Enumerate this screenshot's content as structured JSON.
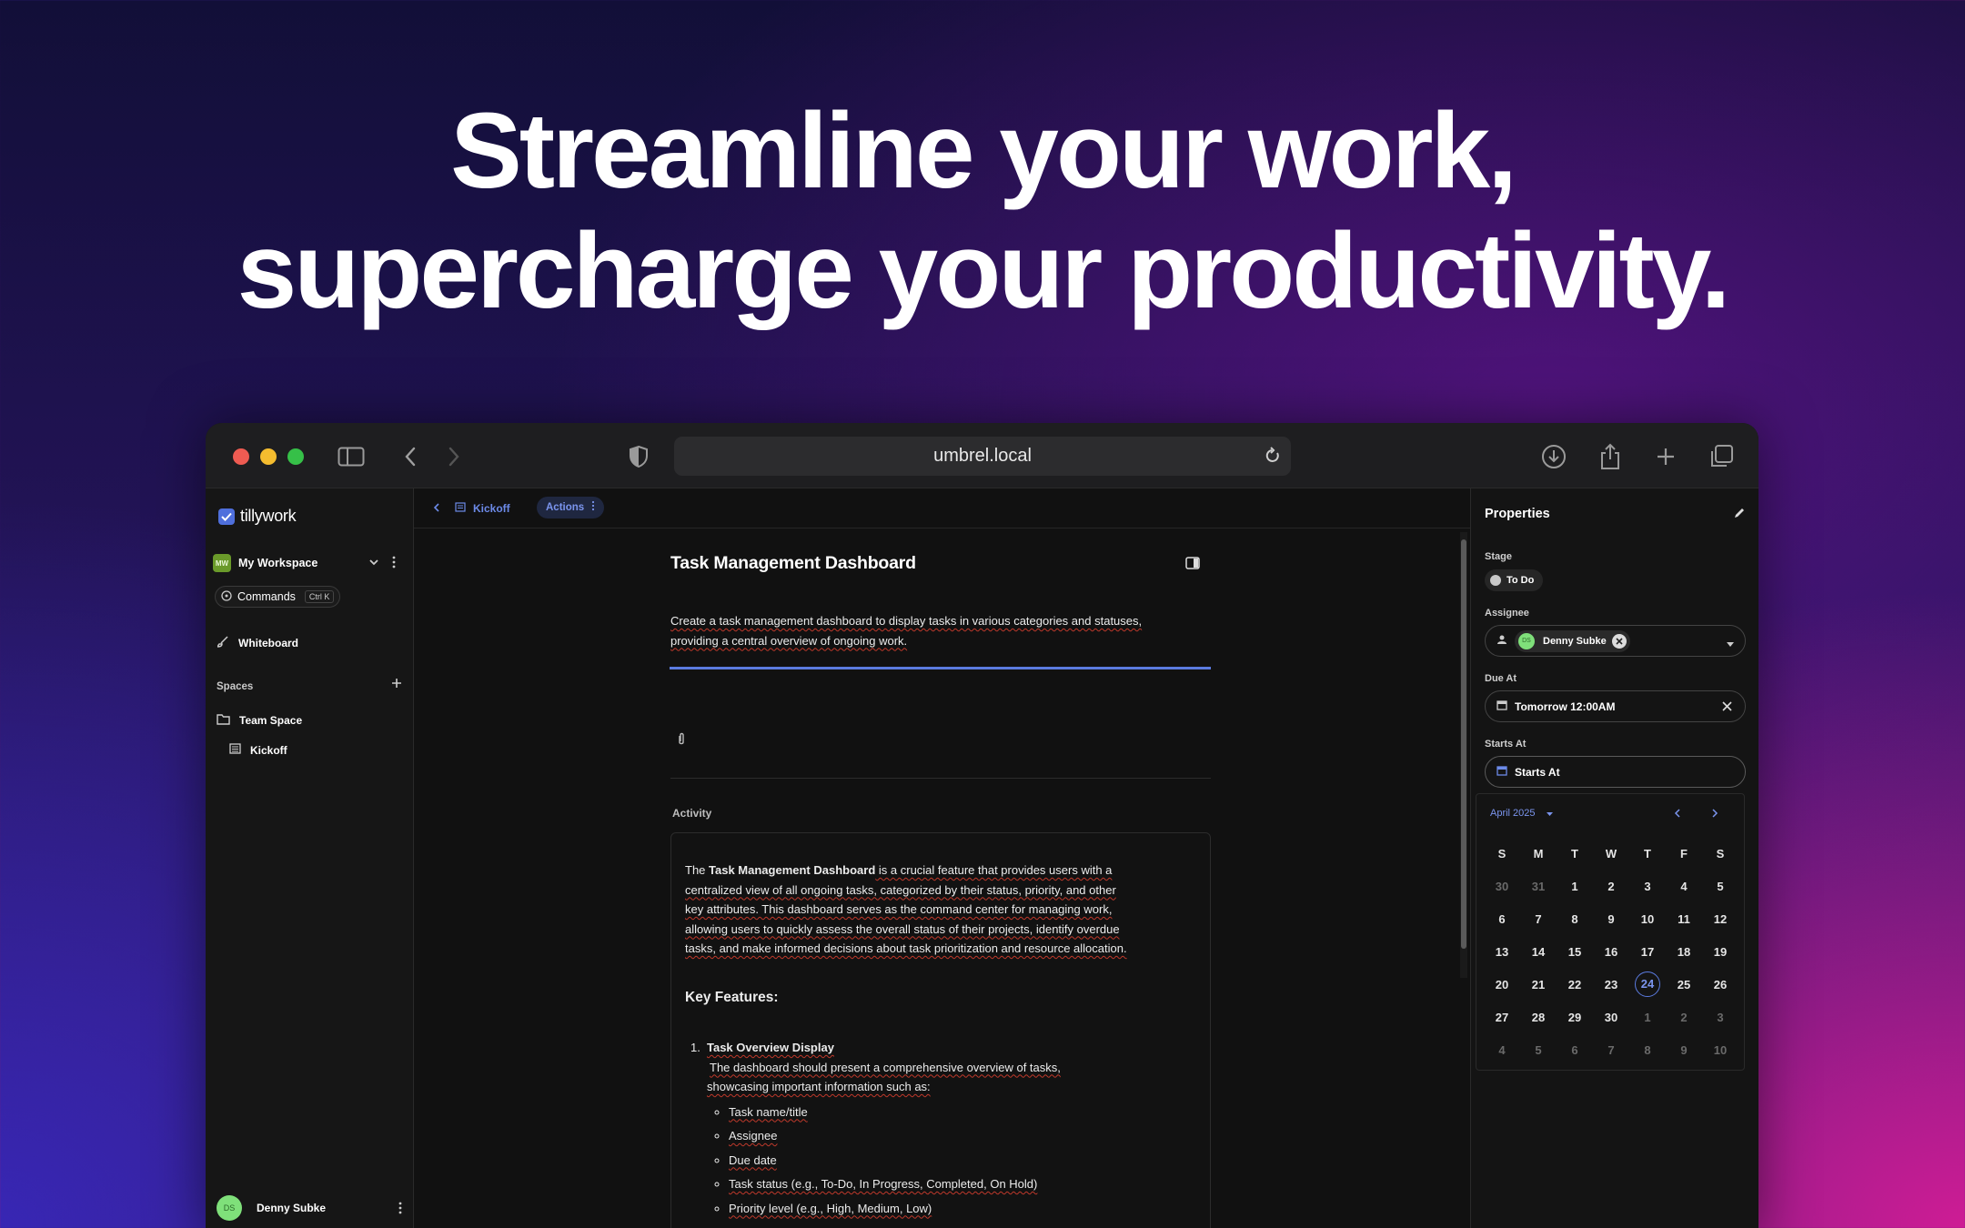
{
  "hero": {
    "line1": "Streamline your work,",
    "line2": "supercharge your productivity."
  },
  "browser": {
    "url": "umbrel.local"
  },
  "sidebar": {
    "logo": "tillywork",
    "workspace_badge": "MW",
    "workspace": "My Workspace",
    "commands": "Commands",
    "commands_kbd": "Ctrl K",
    "whiteboard": "Whiteboard",
    "spaces_label": "Spaces",
    "team_space": "Team Space",
    "kickoff": "Kickoff",
    "user_badge": "DS",
    "user": "Denny Subke"
  },
  "main": {
    "breadcrumb": "Kickoff",
    "actions": "Actions",
    "title": "Task Management Dashboard",
    "description_a": "Create a task management dashboard to display tasks in various categories and statuses,",
    "description_b": "providing a central overview of ongoing work.",
    "activity_label": "Activity",
    "p1_a": "The ",
    "p1_b": "Task Management Dashboard",
    "p1_c": " is a crucial feature that provides users with a",
    "p1_l2": "centralized view of all ongoing tasks, categorized by their status, priority, and other",
    "p1_l3": "key attributes. This dashboard serves as the command center for managing work,",
    "p1_l4": "allowing users to quickly assess the overall status of their projects, identify overdue",
    "p1_l5": "tasks, and make informed decisions about task prioritization and resource allocation.",
    "key_features": "Key Features:",
    "item1_num": "1.",
    "item1_title": "Task Overview Display",
    "item1_l1": "The dashboard should present a comprehensive overview of tasks,",
    "item1_l2": "showcasing important information such as:",
    "bullets": [
      "Task name/title",
      "Assignee",
      "Due date",
      "Task status (e.g., To-Do, In Progress, Completed, On Hold)",
      "Priority level (e.g., High, Medium, Low)"
    ]
  },
  "properties": {
    "title": "Properties",
    "stage_label": "Stage",
    "stage_value": "To Do",
    "assignee_label": "Assignee",
    "assignee_badge": "DS",
    "assignee_value": "Denny Subke",
    "due_label": "Due At",
    "due_value": "Tomorrow 12:00AM",
    "starts_label": "Starts At",
    "starts_value": "Starts At",
    "calendar": {
      "month": "April 2025",
      "weekdays": [
        "S",
        "M",
        "T",
        "W",
        "T",
        "F",
        "S"
      ],
      "weeks": [
        [
          "30",
          "31",
          "1",
          "2",
          "3",
          "4",
          "5"
        ],
        [
          "6",
          "7",
          "8",
          "9",
          "10",
          "11",
          "12"
        ],
        [
          "13",
          "14",
          "15",
          "16",
          "17",
          "18",
          "19"
        ],
        [
          "20",
          "21",
          "22",
          "23",
          "24",
          "25",
          "26"
        ],
        [
          "27",
          "28",
          "29",
          "30",
          "1",
          "2",
          "3"
        ],
        [
          "4",
          "5",
          "6",
          "7",
          "8",
          "9",
          "10"
        ]
      ],
      "selected": "24"
    }
  },
  "colors": {
    "accent": "#5b7be0",
    "avatar_green": "#7fe07a",
    "traffic_red": "#ee5b52",
    "traffic_yellow": "#f4bc2f",
    "traffic_green": "#36c048"
  }
}
